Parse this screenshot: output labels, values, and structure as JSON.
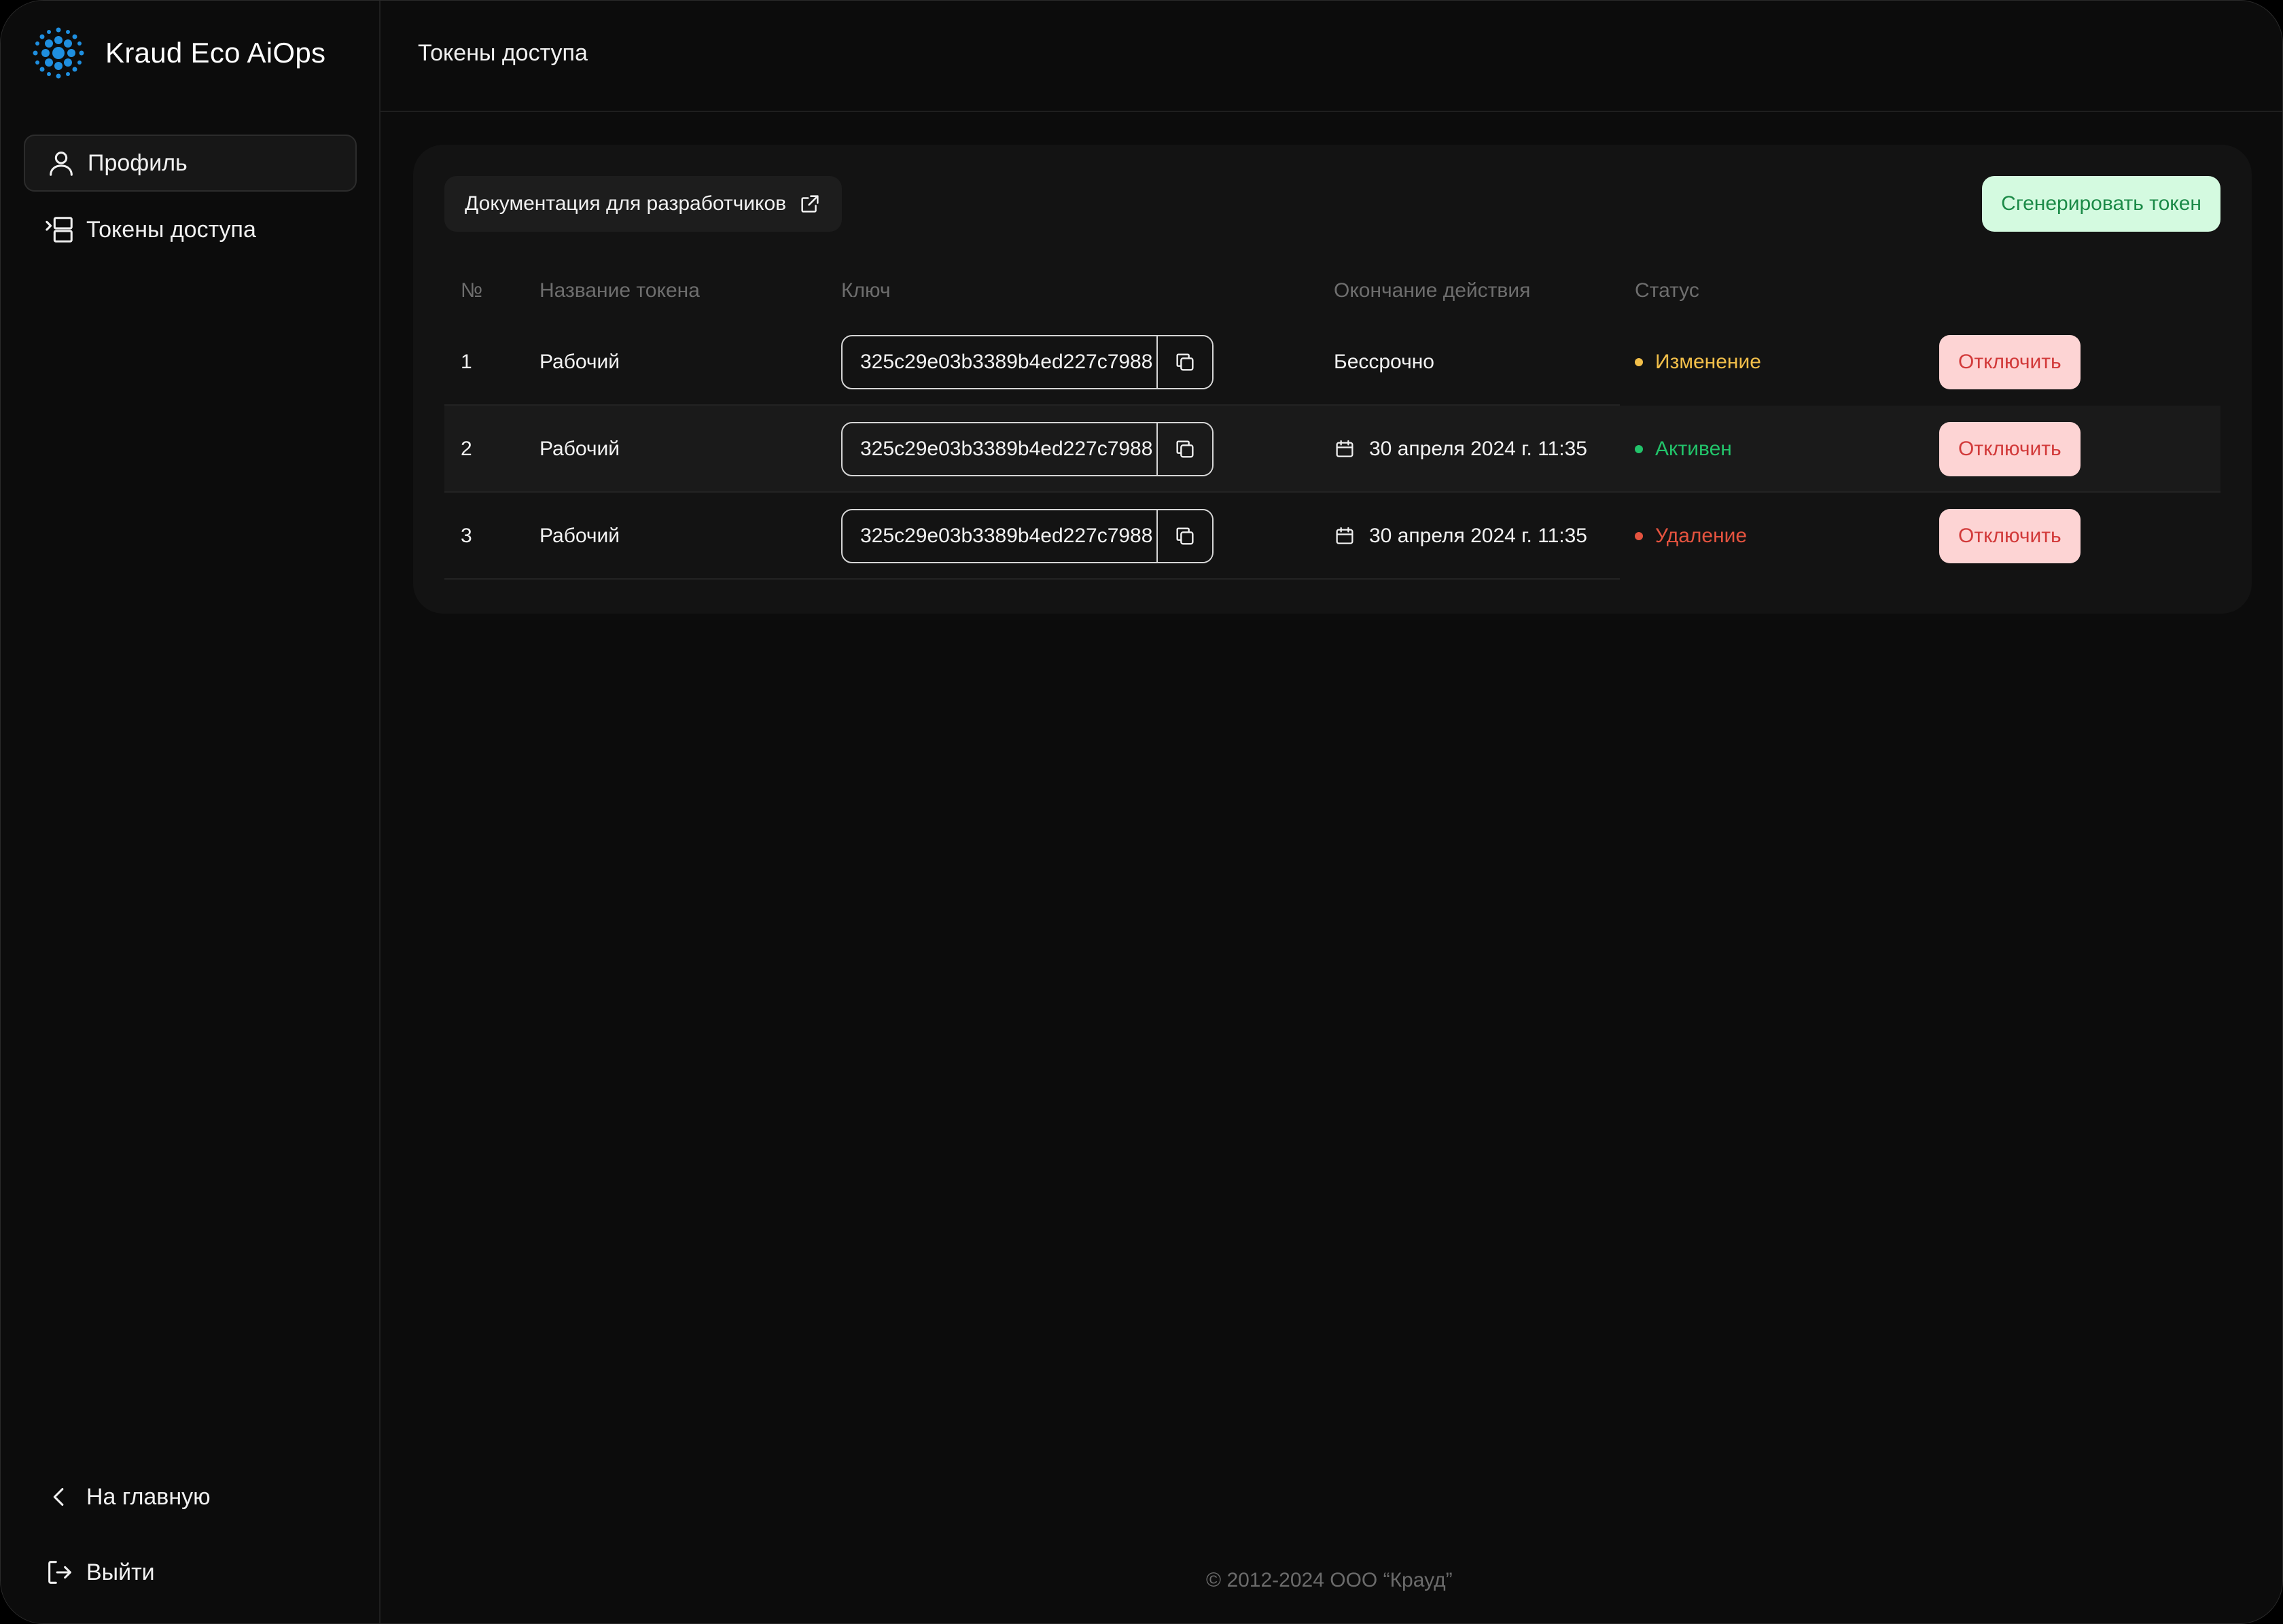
{
  "app": {
    "name": "Kraud Eco AiOps"
  },
  "sidebar": {
    "items": [
      {
        "label": "Профиль",
        "icon": "user-icon",
        "active": true
      },
      {
        "label": "Токены доступа",
        "icon": "tokens-icon",
        "active": false
      }
    ],
    "home_label": "На главную",
    "logout_label": "Выйти"
  },
  "page": {
    "title": "Токены доступа"
  },
  "toolbar": {
    "docs_label": "Документация для разработчиков",
    "generate_label": "Сгенерировать токен"
  },
  "table": {
    "headers": {
      "num": "№",
      "name": "Название токена",
      "key": "Ключ",
      "expires": "Окончание действия",
      "status": "Статус"
    },
    "rows": [
      {
        "num": "1",
        "name": "Рабочий",
        "key": "325c29e03b3389b4ed227c7988",
        "expires": "Бессрочно",
        "status": "Изменение",
        "status_color": "#f2bf4a",
        "action": "Отключить"
      },
      {
        "num": "2",
        "name": "Рабочий",
        "key": "325c29e03b3389b4ed227c7988",
        "expires": "30 апреля 2024 г. 11:35",
        "status": "Активен",
        "status_color": "#22c36a",
        "action": "Отключить"
      },
      {
        "num": "3",
        "name": "Рабочий",
        "key": "325c29e03b3389b4ed227c7988",
        "expires": "30 апреля 2024 г. 11:35",
        "status": "Удаление",
        "status_color": "#e5533f",
        "action": "Отключить"
      }
    ]
  },
  "footer": {
    "text": "© 2012-2024 ООО “Крауд”"
  },
  "colors": {
    "accent_green_bg": "#d4fae0",
    "accent_green_text": "#1b8a47",
    "danger_bg": "#fdd4d4",
    "danger_text": "#d23a3a"
  }
}
